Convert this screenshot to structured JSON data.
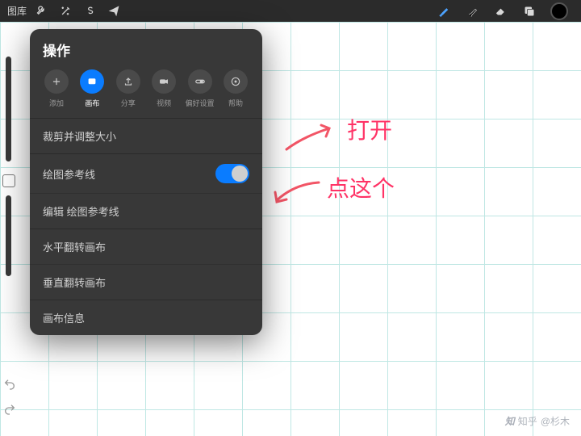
{
  "topbar": {
    "gallery": "图库"
  },
  "panel": {
    "title": "操作",
    "tabs": [
      {
        "label": "添加"
      },
      {
        "label": "画布"
      },
      {
        "label": "分享"
      },
      {
        "label": "视频"
      },
      {
        "label": "偏好设置"
      },
      {
        "label": "帮助"
      }
    ],
    "rows": {
      "crop": "裁剪并调整大小",
      "guides": "绘图参考线",
      "guides_on": true,
      "edit_guides": "编辑 绘图参考线",
      "flip_h": "水平翻转画布",
      "flip_v": "垂直翻转画布",
      "info": "画布信息"
    }
  },
  "annotations": {
    "open": "打开",
    "tap_this": "点这个"
  },
  "watermark": {
    "site": "知乎",
    "user": "@杉木"
  }
}
